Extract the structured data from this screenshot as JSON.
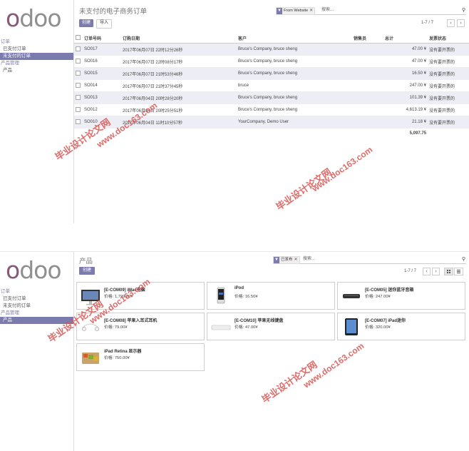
{
  "orders_screen": {
    "logo": "odoo",
    "menu": [
      {
        "label": "订单",
        "kind": "section"
      },
      {
        "label": "已支付订单",
        "kind": "item"
      },
      {
        "label": "未支付的订单",
        "kind": "active"
      },
      {
        "label": "产品管理",
        "kind": "section"
      },
      {
        "label": "产品",
        "kind": "item"
      }
    ],
    "title": "未支付的电子商务订单",
    "create_label": "创建",
    "import_label": "导入",
    "search": {
      "facet": "From Website",
      "placeholder": "搜索..."
    },
    "pager": "1-7 / 7",
    "columns": [
      "订单号码",
      "订购日期",
      "客户",
      "销售员",
      "总计",
      "发票状态"
    ],
    "rows": [
      {
        "order": "SO017",
        "date": "2017年06月07日 22时12分26秒",
        "customer": "Bruce's Company, bruce sheng",
        "salesperson": "",
        "total": "47.00 ¥",
        "invoice": "没有要开票的"
      },
      {
        "order": "SO016",
        "date": "2017年06月07日 22时08分17秒",
        "customer": "Bruce's Company, bruce sheng",
        "salesperson": "",
        "total": "47.00 ¥",
        "invoice": "没有要开票的"
      },
      {
        "order": "SO015",
        "date": "2017年06月07日 21时53分46秒",
        "customer": "Bruce's Company, bruce sheng",
        "salesperson": "",
        "total": "16.50 ¥",
        "invoice": "没有要开票的"
      },
      {
        "order": "SO014",
        "date": "2017年06月07日 21时37分45秒",
        "customer": "bruce",
        "salesperson": "",
        "total": "247.00 ¥",
        "invoice": "没有要开票的"
      },
      {
        "order": "SO013",
        "date": "2017年06月04日 20时28分20秒",
        "customer": "Bruce's Company, bruce sheng",
        "salesperson": "",
        "total": "101.39 ¥",
        "invoice": "没有要开票的"
      },
      {
        "order": "SO012",
        "date": "2017年06月04日 20时25分51秒",
        "customer": "Bruce's Company, bruce sheng",
        "salesperson": "",
        "total": "4,613.19 ¥",
        "invoice": "没有要开票的"
      },
      {
        "order": "SO010",
        "date": "2017年06月04日 11时10分57秒",
        "customer": "YourCompany, Demo User",
        "salesperson": "",
        "total": "21.18 ¥",
        "invoice": "没有要开票的"
      }
    ],
    "grand_total": "5,097.75"
  },
  "products_screen": {
    "logo": "odoo",
    "menu": [
      {
        "label": "订单",
        "kind": "section"
      },
      {
        "label": "已支付订单",
        "kind": "item"
      },
      {
        "label": "未支付的订单",
        "kind": "item"
      },
      {
        "label": "产品管理",
        "kind": "section"
      },
      {
        "label": "产品",
        "kind": "active"
      }
    ],
    "title": "产品",
    "create_label": "创建",
    "search": {
      "facet": "已发布",
      "placeholder": "搜索..."
    },
    "pager": "1-7 / 7",
    "products": [
      {
        "name": "[E-COM09] iMac电脑",
        "price": "价格: 1,799.00¥",
        "icon": "imac-icon"
      },
      {
        "name": "iPod",
        "price": "价格: 16.50¥",
        "icon": "ipod-icon"
      },
      {
        "name": "[E-COM05] 迷你蓝牙音箱",
        "price": "价格: 247.00¥",
        "icon": "speaker-icon"
      },
      {
        "name": "[E-COM08] 苹果入耳式耳机",
        "price": "价格: 79.00¥",
        "icon": "earphones-icon"
      },
      {
        "name": "[E-COM10] 苹果无线键盘",
        "price": "价格: 47.00¥",
        "icon": "keyboard-icon"
      },
      {
        "name": "[E-COM07] iPad迷你",
        "price": "价格: 320.00¥",
        "icon": "ipad-icon"
      },
      {
        "name": "iPad Retina 显示器",
        "price": "价格: 750.00¥",
        "icon": "ipad-retina-icon"
      }
    ]
  },
  "watermark": {
    "text1": "毕业设计论文网",
    "text2": "www.doc163.com"
  },
  "colors": {
    "brand": "#7c7bad",
    "logo_purple": "#875a7b",
    "row_stripe": "#ededf5"
  }
}
